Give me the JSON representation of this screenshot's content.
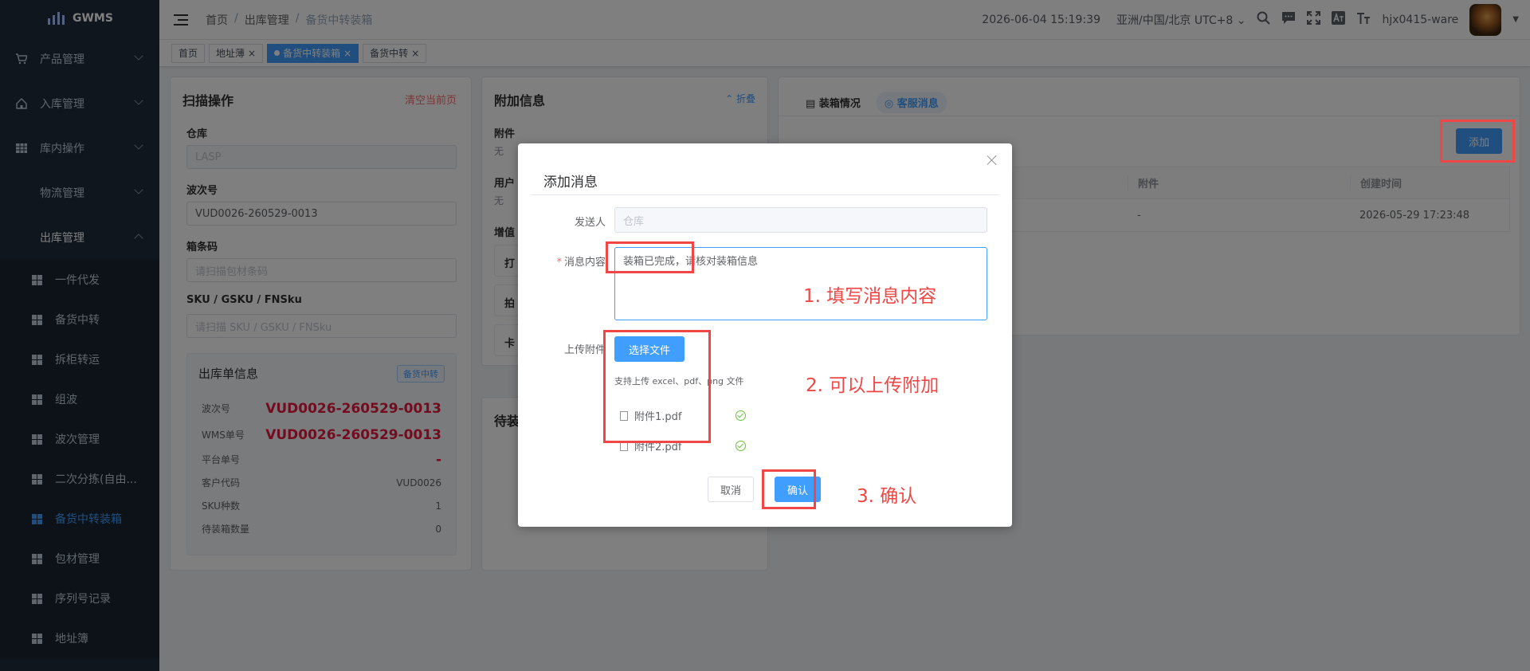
{
  "app": {
    "logo": "GWMS"
  },
  "sidebar": {
    "items": [
      {
        "label": "产品管理",
        "icon": "cart-icon"
      },
      {
        "label": "入库管理",
        "icon": "home-icon"
      },
      {
        "label": "库内操作",
        "icon": "table-icon"
      },
      {
        "label": "物流管理",
        "icon": "grid-icon"
      },
      {
        "label": "出库管理",
        "icon": "grid-icon"
      }
    ],
    "sub_items": [
      "一件代发",
      "备货中转",
      "拆柜转运",
      "组波",
      "波次管理",
      "二次分拣(自由...",
      "备货中转装箱",
      "包材管理",
      "序列号记录",
      "地址簿"
    ]
  },
  "header": {
    "breadcrumb": [
      "首页",
      "/",
      "出库管理",
      "/",
      "备货中转装箱"
    ],
    "datetime": "2026-06-04 15:19:39",
    "timezone": "亚洲/中国/北京 UTC+8",
    "username": "hjx0415-ware"
  },
  "tags": [
    "首页",
    "地址薄",
    "备货中转装箱",
    "备货中转"
  ],
  "scan": {
    "title": "扫描操作",
    "clear": "清空当前页",
    "warehouse_label": "仓库",
    "warehouse_value": "LASP",
    "wave_label": "波次号",
    "wave_value": "VUD0026-260529-0013",
    "box_label": "箱条码",
    "box_placeholder": "请扫描包材条码",
    "sku_label": "SKU / GSKU / FNSku",
    "sku_placeholder": "请扫描 SKU / GSKU / FNSku"
  },
  "order": {
    "title": "出库单信息",
    "badge": "备货中转",
    "rows": [
      {
        "k": "波次号",
        "v": "VUD0026-260529-0013"
      },
      {
        "k": "WMS单号",
        "v": "VUD0026-260529-0013"
      },
      {
        "k": "平台单号",
        "v": "-"
      },
      {
        "k": "客户代码",
        "v": "VUD0026"
      },
      {
        "k": "SKU种数",
        "v": "1"
      },
      {
        "k": "待装箱数量",
        "v": "0"
      }
    ]
  },
  "extra": {
    "title": "附加信息",
    "fold": "折叠",
    "attach_label": "附件",
    "attach_value": "无",
    "user_label": "用户",
    "user_value": "无",
    "add_label": "增值",
    "s1": "打",
    "s2": "拍",
    "s3": "卡",
    "pending": "待装"
  },
  "right": {
    "tab1": "装箱情况",
    "tab2": "客服消息",
    "add_btn": "添加",
    "col_attach": "附件",
    "col_created": "创建时间",
    "row_attach": "-",
    "row_created": "2026-05-29 17:23:48"
  },
  "dialog": {
    "title": "添加消息",
    "sender_label": "发送人",
    "sender_placeholder": "仓库",
    "content_label": "消息内容",
    "content_value": "装箱已完成，请核对装箱信息",
    "upload_label": "上传附件",
    "choose_file": "选择文件",
    "upload_hint": "支持上传 excel、pdf、png 文件",
    "files": [
      "附件1.pdf",
      "附件2.pdf"
    ],
    "cancel": "取消",
    "confirm": "确认"
  },
  "annotations": {
    "a1": "1. 填写消息内容",
    "a2": "2. 可以上传附加",
    "a3": "3. 确认"
  },
  "colors": {
    "primary": "#409eff",
    "sidebar": "#1f2d3d",
    "annotation": "#f04646",
    "danger": "#e4193d"
  }
}
